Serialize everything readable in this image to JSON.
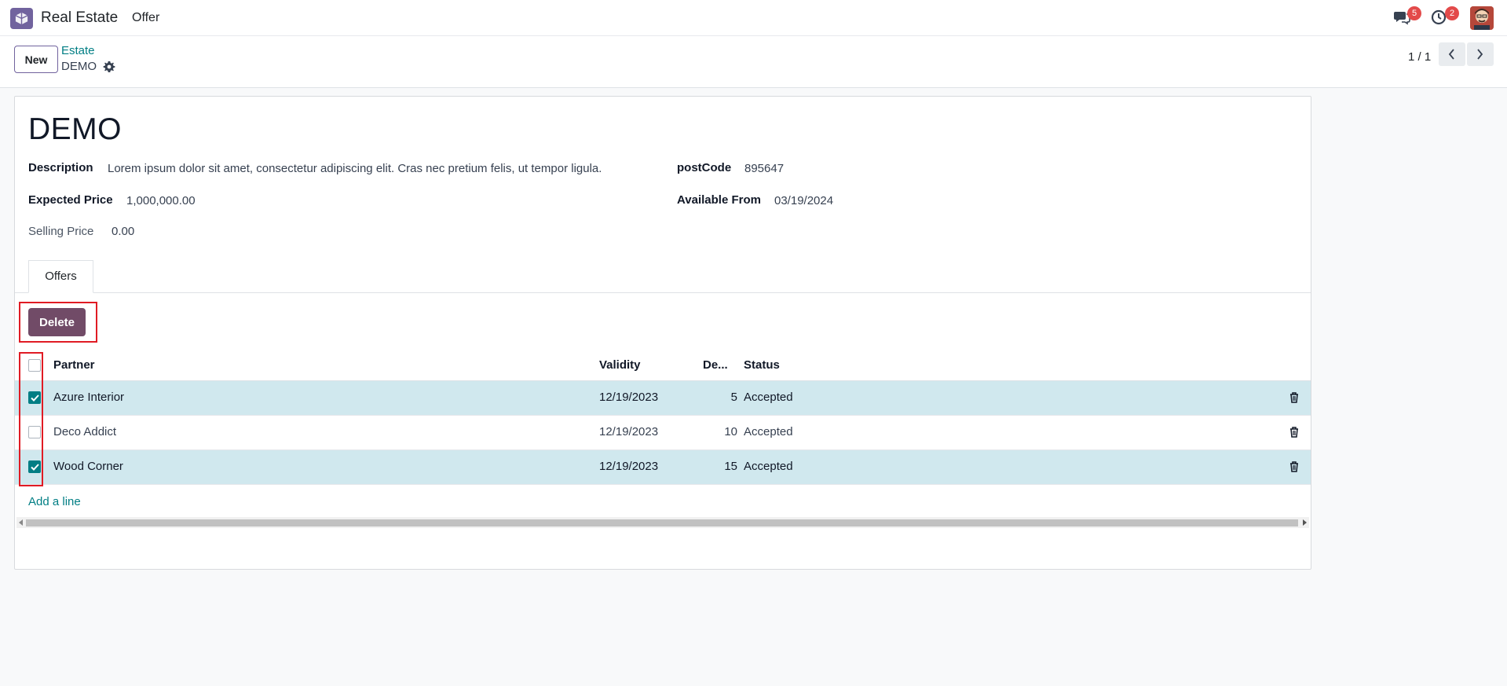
{
  "navbar": {
    "app_name": "Real Estate",
    "menu_items": [
      "Offer"
    ],
    "messages_count": "5",
    "activities_count": "2",
    "brand_color": "#71639e"
  },
  "control": {
    "new_label": "New",
    "breadcrumb_parent": "Estate",
    "breadcrumb_current": "DEMO",
    "pager_value": "1 / 1"
  },
  "record": {
    "title": "DEMO",
    "fields": {
      "description_label": "Description",
      "description_value": "Lorem ipsum dolor sit amet, consectetur adipiscing elit. Cras nec pretium felis, ut tempor ligula.",
      "postcode_label": "postCode",
      "postcode_value": "895647",
      "expected_price_label": "Expected Price",
      "expected_price_value": "1,000,000.00",
      "available_from_label": "Available From",
      "available_from_value": "03/19/2024",
      "selling_price_label": "Selling Price",
      "selling_price_value": "0.00"
    }
  },
  "tabs": [
    {
      "label": "Offers",
      "active": true
    }
  ],
  "offers": {
    "delete_label": "Delete",
    "columns": {
      "partner": "Partner",
      "validity": "Validity",
      "deadline": "De...",
      "status": "Status"
    },
    "rows": [
      {
        "partner": "Azure Interior",
        "validity": "12/19/2023",
        "deadline": "5",
        "status": "Accepted",
        "selected": true
      },
      {
        "partner": "Deco Addict",
        "validity": "12/19/2023",
        "deadline": "10",
        "status": "Accepted",
        "selected": false
      },
      {
        "partner": "Wood Corner",
        "validity": "12/19/2023",
        "deadline": "15",
        "status": "Accepted",
        "selected": true
      }
    ],
    "add_line_label": "Add a line"
  },
  "colors": {
    "accent": "#714b67",
    "link": "#017e84",
    "selected_row": "#d0e8ee",
    "highlight": "#e01b24"
  }
}
